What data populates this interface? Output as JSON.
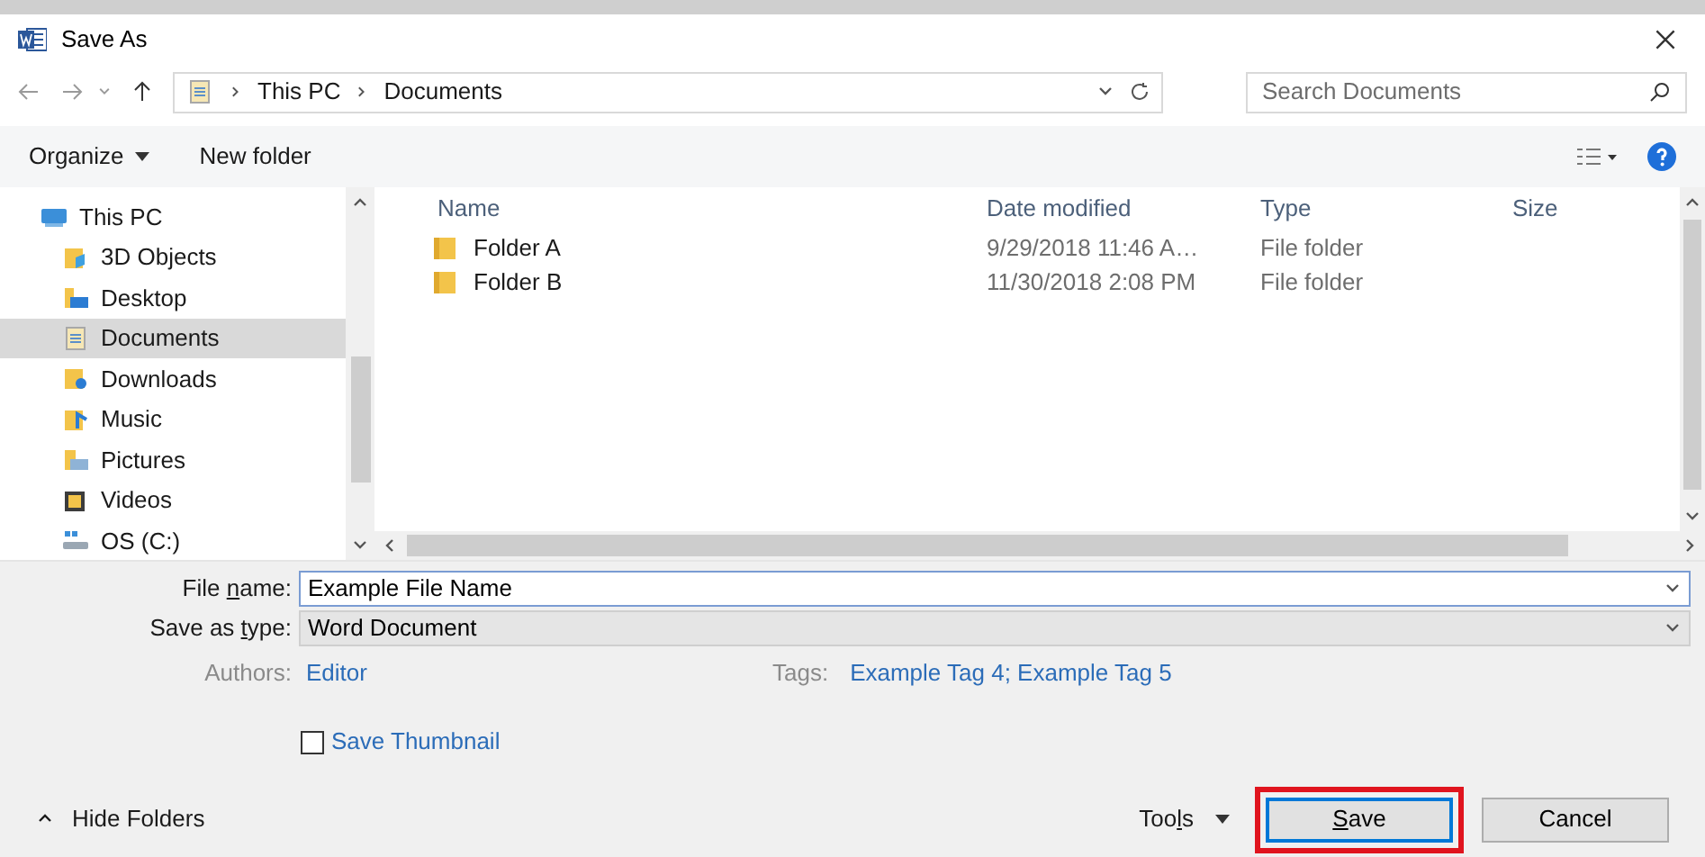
{
  "window": {
    "title": "Save As"
  },
  "address_bar": {
    "path": [
      "This PC",
      "Documents"
    ]
  },
  "search": {
    "placeholder": "Search Documents"
  },
  "toolbar": {
    "organize": "Organize",
    "new_folder": "New folder"
  },
  "sidebar": {
    "items": [
      {
        "label": "This PC",
        "kind": "pc",
        "selected": false,
        "children": [
          {
            "label": "3D Objects",
            "kind": "objects",
            "selected": false
          },
          {
            "label": "Desktop",
            "kind": "desktop",
            "selected": false
          },
          {
            "label": "Documents",
            "kind": "documents",
            "selected": true
          },
          {
            "label": "Downloads",
            "kind": "downloads",
            "selected": false
          },
          {
            "label": "Music",
            "kind": "music",
            "selected": false
          },
          {
            "label": "Pictures",
            "kind": "pictures",
            "selected": false
          },
          {
            "label": "Videos",
            "kind": "videos",
            "selected": false
          },
          {
            "label": "OS (C:)",
            "kind": "drive",
            "selected": false
          }
        ]
      }
    ]
  },
  "file_list": {
    "columns": [
      "Name",
      "Date modified",
      "Type",
      "Size"
    ],
    "rows": [
      {
        "name": "Folder A",
        "date": "9/29/2018 11:46 A…",
        "type": "File folder"
      },
      {
        "name": "Folder B",
        "date": "11/30/2018 2:08 PM",
        "type": "File folder"
      }
    ]
  },
  "form": {
    "file_name": {
      "label": [
        {
          "text": "File ",
          "underline": false
        },
        {
          "text": "n",
          "underline": true
        },
        {
          "text": "ame:",
          "underline": false
        }
      ],
      "value": "Example File Name"
    },
    "save_as_type": {
      "label": [
        {
          "text": "Save as ",
          "underline": false
        },
        {
          "text": "t",
          "underline": true
        },
        {
          "text": "ype:",
          "underline": false
        }
      ],
      "value": "Word Document"
    },
    "authors": {
      "label": "Authors:",
      "value": "Editor"
    },
    "tags": {
      "label": "Tags:",
      "value": "Example Tag 4; Example Tag 5"
    },
    "save_thumbnail": {
      "label": "Save Thumbnail",
      "checked": false
    }
  },
  "footer": {
    "hide_folders": "Hide Folders",
    "tools": [
      {
        "text": "Too",
        "underline": false
      },
      {
        "text": "l",
        "underline": true
      },
      {
        "text": "s",
        "underline": false
      }
    ],
    "save": {
      "label": [
        {
          "text": "S",
          "underline": true
        },
        {
          "text": "ave",
          "underline": false
        }
      ],
      "highlighted": true
    },
    "cancel": "Cancel"
  }
}
